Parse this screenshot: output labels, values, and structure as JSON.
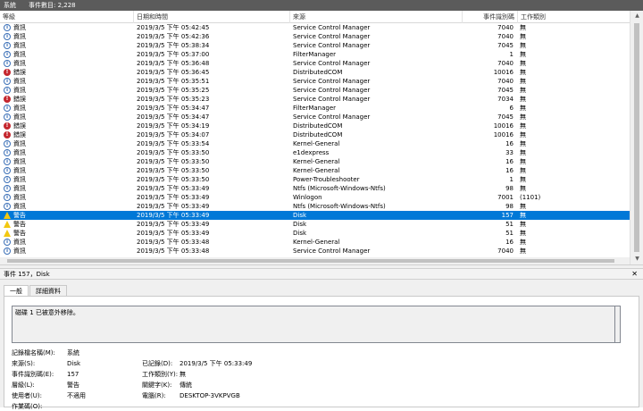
{
  "titlebar": {
    "log_name": "系統",
    "count_label": "事件數目: 2,228"
  },
  "columns": [
    "等級",
    "日期和時間",
    "來源",
    "事件識別碼",
    "工作類別"
  ],
  "rows": [
    {
      "level": "info",
      "level_text": "資訊",
      "datetime": "2019/3/5 下午 05:42:45",
      "source": "Service Control Manager",
      "id": "7040",
      "category": "無"
    },
    {
      "level": "info",
      "level_text": "資訊",
      "datetime": "2019/3/5 下午 05:42:36",
      "source": "Service Control Manager",
      "id": "7040",
      "category": "無"
    },
    {
      "level": "info",
      "level_text": "資訊",
      "datetime": "2019/3/5 下午 05:38:34",
      "source": "Service Control Manager",
      "id": "7045",
      "category": "無"
    },
    {
      "level": "info",
      "level_text": "資訊",
      "datetime": "2019/3/5 下午 05:37:00",
      "source": "FilterManager",
      "id": "1",
      "category": "無"
    },
    {
      "level": "info",
      "level_text": "資訊",
      "datetime": "2019/3/5 下午 05:36:48",
      "source": "Service Control Manager",
      "id": "7040",
      "category": "無"
    },
    {
      "level": "err",
      "level_text": "錯誤",
      "datetime": "2019/3/5 下午 05:36:45",
      "source": "DistributedCOM",
      "id": "10016",
      "category": "無"
    },
    {
      "level": "info",
      "level_text": "資訊",
      "datetime": "2019/3/5 下午 05:35:51",
      "source": "Service Control Manager",
      "id": "7040",
      "category": "無"
    },
    {
      "level": "info",
      "level_text": "資訊",
      "datetime": "2019/3/5 下午 05:35:25",
      "source": "Service Control Manager",
      "id": "7045",
      "category": "無"
    },
    {
      "level": "err",
      "level_text": "錯誤",
      "datetime": "2019/3/5 下午 05:35:23",
      "source": "Service Control Manager",
      "id": "7034",
      "category": "無"
    },
    {
      "level": "info",
      "level_text": "資訊",
      "datetime": "2019/3/5 下午 05:34:47",
      "source": "FilterManager",
      "id": "6",
      "category": "無"
    },
    {
      "level": "info",
      "level_text": "資訊",
      "datetime": "2019/3/5 下午 05:34:47",
      "source": "Service Control Manager",
      "id": "7045",
      "category": "無"
    },
    {
      "level": "err",
      "level_text": "錯誤",
      "datetime": "2019/3/5 下午 05:34:19",
      "source": "DistributedCOM",
      "id": "10016",
      "category": "無"
    },
    {
      "level": "err",
      "level_text": "錯誤",
      "datetime": "2019/3/5 下午 05:34:07",
      "source": "DistributedCOM",
      "id": "10016",
      "category": "無"
    },
    {
      "level": "info",
      "level_text": "資訊",
      "datetime": "2019/3/5 下午 05:33:54",
      "source": "Kernel-General",
      "id": "16",
      "category": "無"
    },
    {
      "level": "info",
      "level_text": "資訊",
      "datetime": "2019/3/5 下午 05:33:50",
      "source": "e1dexpress",
      "id": "33",
      "category": "無"
    },
    {
      "level": "info",
      "level_text": "資訊",
      "datetime": "2019/3/5 下午 05:33:50",
      "source": "Kernel-General",
      "id": "16",
      "category": "無"
    },
    {
      "level": "info",
      "level_text": "資訊",
      "datetime": "2019/3/5 下午 05:33:50",
      "source": "Kernel-General",
      "id": "16",
      "category": "無"
    },
    {
      "level": "info",
      "level_text": "資訊",
      "datetime": "2019/3/5 下午 05:33:50",
      "source": "Power-Troubleshooter",
      "id": "1",
      "category": "無"
    },
    {
      "level": "info",
      "level_text": "資訊",
      "datetime": "2019/3/5 下午 05:33:49",
      "source": "Ntfs (Microsoft-Windows-Ntfs)",
      "id": "98",
      "category": "無"
    },
    {
      "level": "info",
      "level_text": "資訊",
      "datetime": "2019/3/5 下午 05:33:49",
      "source": "Winlogon",
      "id": "7001",
      "category": "(1101)"
    },
    {
      "level": "info",
      "level_text": "資訊",
      "datetime": "2019/3/5 下午 05:33:49",
      "source": "Ntfs (Microsoft-Windows-Ntfs)",
      "id": "98",
      "category": "無"
    },
    {
      "level": "warn",
      "level_text": "警告",
      "datetime": "2019/3/5 下午 05:33:49",
      "source": "Disk",
      "id": "157",
      "category": "無",
      "selected": true
    },
    {
      "level": "warn",
      "level_text": "警告",
      "datetime": "2019/3/5 下午 05:33:49",
      "source": "Disk",
      "id": "51",
      "category": "無"
    },
    {
      "level": "warn",
      "level_text": "警告",
      "datetime": "2019/3/5 下午 05:33:49",
      "source": "Disk",
      "id": "51",
      "category": "無"
    },
    {
      "level": "info",
      "level_text": "資訊",
      "datetime": "2019/3/5 下午 05:33:48",
      "source": "Kernel-General",
      "id": "16",
      "category": "無"
    },
    {
      "level": "info",
      "level_text": "資訊",
      "datetime": "2019/3/5 下午 05:33:48",
      "source": "Service Control Manager",
      "id": "7040",
      "category": "無"
    }
  ],
  "detail": {
    "header": "事件 157，Disk",
    "close": "✕",
    "tabs": [
      "一般",
      "詳細資料"
    ],
    "message": "磁碟 1 已被意外移除。",
    "fields": {
      "log_name_label": "記錄檔名稱(M):",
      "log_name": "系統",
      "source_label": "來源(S):",
      "source": "Disk",
      "logged_label": "已記錄(D):",
      "logged": "2019/3/5 下午 05:33:49",
      "event_id_label": "事件識別碼(E):",
      "event_id": "157",
      "task_label": "工作類別(Y):",
      "task": "無",
      "level_label": "層級(L):",
      "level": "警告",
      "keywords_label": "關鍵字(K):",
      "keywords": "傳統",
      "user_label": "使用者(U):",
      "user": "不適用",
      "computer_label": "電腦(R):",
      "computer": "DESKTOP-3VKPVGB",
      "opcode_label": "作業碼(O):"
    }
  }
}
